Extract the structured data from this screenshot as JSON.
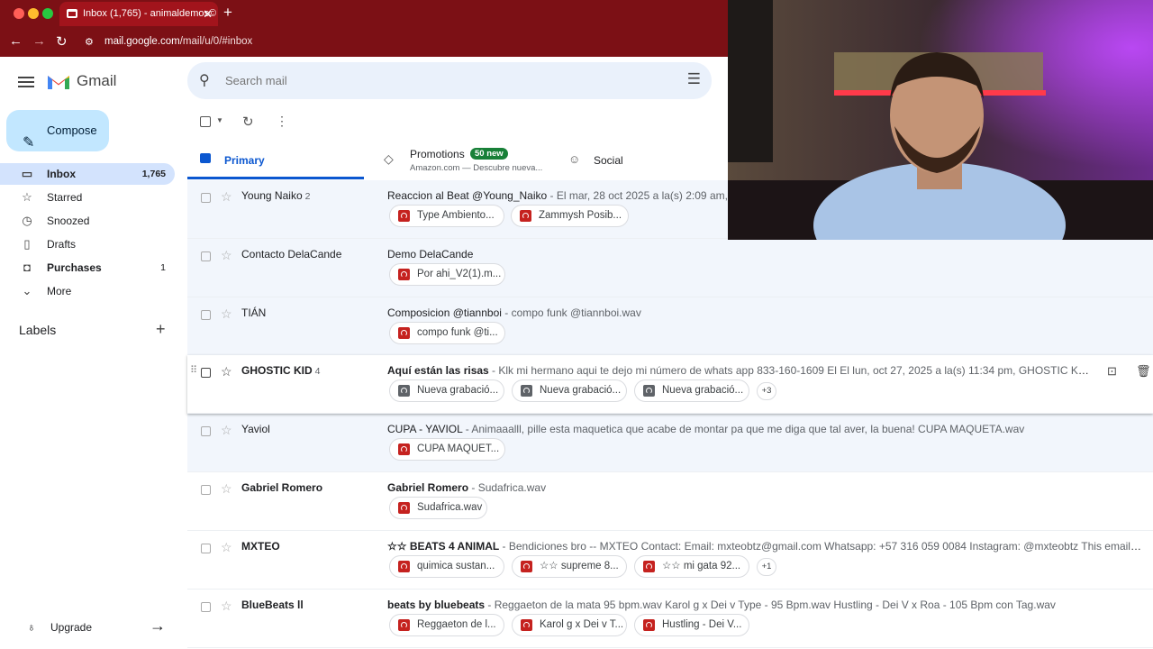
{
  "browser": {
    "tab_title": "Inbox (1,765) - animaldemos©",
    "url_host": "mail.google.com",
    "url_path": "/mail/u/0/#inbox",
    "accent": "#7c1015"
  },
  "sidebar": {
    "brand": "Gmail",
    "compose_label": "Compose",
    "items": [
      {
        "label": "Inbox",
        "count": "1,765",
        "icon": "inbox-icon"
      },
      {
        "label": "Starred",
        "count": "",
        "icon": "star-icon"
      },
      {
        "label": "Snoozed",
        "count": "",
        "icon": "clock-icon"
      },
      {
        "label": "Drafts",
        "count": "",
        "icon": "draft-icon"
      },
      {
        "label": "Purchases",
        "count": "1",
        "icon": "bag-icon"
      },
      {
        "label": "More",
        "count": "",
        "icon": "chevron-down-icon"
      }
    ],
    "labels_heading": "Labels",
    "upgrade_label": "Upgrade"
  },
  "search": {
    "placeholder": "Search mail"
  },
  "tabs": {
    "primary": "Primary",
    "promotions": "Promotions",
    "promotions_badge": "50 new",
    "promotions_sub": "Amazon.com — Descubre nueva...",
    "social": "Social"
  },
  "emails": [
    {
      "sender": "Young Naiko",
      "count": "2",
      "subject": "Reaccion al Beat @Young_Naiko",
      "snippet": " - El mar, 28 oct 2025 a la(s) 2:09 am, Young",
      "attachments": [
        "Type Ambiento...",
        "Zammysh Posib..."
      ],
      "more": ""
    },
    {
      "sender": "Contacto DelaCande",
      "count": "",
      "subject": "Demo DelaCande",
      "snippet": "",
      "attachments": [
        "Por ahi_V2(1).m..."
      ],
      "more": ""
    },
    {
      "sender": "TIÁN",
      "count": "",
      "subject": "Composicion @tiannboi",
      "snippet": " - compo funk @tiannboi.wav",
      "attachments": [
        "compo funk @ti..."
      ],
      "more": ""
    },
    {
      "sender": "GHOSTIC KID",
      "count": "4",
      "subject": "Aquí están las risas",
      "snippet": " - Klk mi hermano aqui te dejo mi número de whats app 833-160-1609 El El lun, oct 27, 2025 a la(s) 11:34 pm, GHOSTIC KID <jm663...",
      "attachments": [
        "Nueva grabació...",
        "Nueva grabació...",
        "Nueva grabació..."
      ],
      "more": "+3"
    },
    {
      "sender": "Yaviol",
      "count": "",
      "subject": "CUPA - YAVIOL",
      "snippet": " - Animaaalll, pille esta maquetica que acabe de montar pa que me diga que tal aver, la buena! CUPA MAQUETA.wav",
      "attachments": [
        "CUPA MAQUET..."
      ],
      "more": ""
    },
    {
      "sender": "Gabriel Romero",
      "count": "",
      "subject": "Gabriel Romero",
      "snippet": " - Sudafrica.wav",
      "attachments": [
        "Sudafrica.wav"
      ],
      "more": ""
    },
    {
      "sender": "MXTEO",
      "count": "",
      "subject": "☆☆ BEATS 4 ANIMAL",
      "snippet": " - Bendiciones bro -- MXTEO Contact: Email: mxteobtz@gmail.com Whatsapp: +57 316 059 0084 Instagram: @mxteobtz This email and its ...",
      "attachments": [
        "quimica sustan...",
        "☆☆ supreme 8...",
        "☆☆ mi gata 92..."
      ],
      "more": "+1"
    },
    {
      "sender": "BlueBeats ll",
      "count": "",
      "subject": "beats by bluebeats",
      "snippet": " - Reggaeton de la mata 95 bpm.wav Karol g x Dei v Type - 95 Bpm.wav Hustling - Dei V x Roa - 105 Bpm con Tag.wav",
      "attachments": [
        "Reggaeton de l...",
        "Karol g x Dei v T...",
        "Hustling - Dei V..."
      ],
      "more": ""
    }
  ]
}
